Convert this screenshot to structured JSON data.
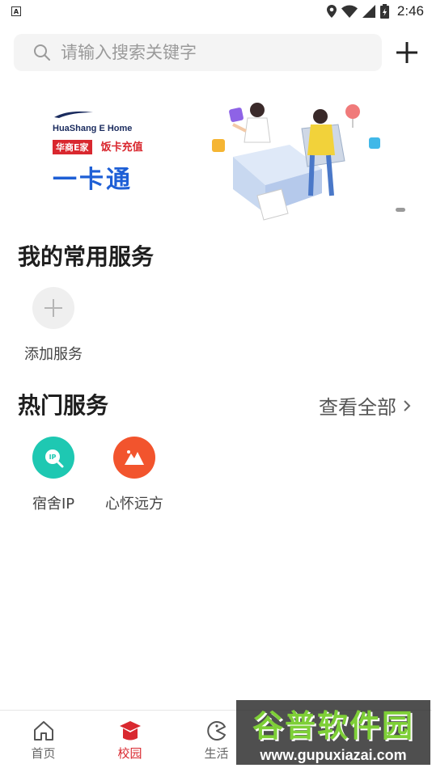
{
  "status_bar": {
    "sim_label": "A",
    "time": "2:46"
  },
  "search": {
    "placeholder": "请输入搜索关键字"
  },
  "banner": {
    "brand": "HuaShang E Home",
    "tag_left": "华商E家",
    "tag_right": "饭卡充值",
    "title": "一卡通"
  },
  "my_services": {
    "title": "我的常用服务",
    "items": [
      {
        "label": "添加服务",
        "icon": "plus-icon"
      }
    ]
  },
  "hot_services": {
    "title": "热门服务",
    "view_all": "查看全部",
    "items": [
      {
        "label": "宿舍IP",
        "icon": "ip-icon",
        "color": "#1ec8b2"
      },
      {
        "label": "心怀远方",
        "icon": "mountain-icon",
        "color": "#f2542d"
      }
    ]
  },
  "tabs": [
    {
      "label": "首页",
      "icon": "home-icon",
      "active": false
    },
    {
      "label": "校园",
      "icon": "campus-icon",
      "active": true
    },
    {
      "label": "生活",
      "icon": "life-icon",
      "active": false
    }
  ],
  "watermark": {
    "title": "谷普软件园",
    "url": "www.gupuxiazai.com"
  },
  "colors": {
    "accent": "#d9282f",
    "teal": "#1ec8b2",
    "orange": "#f2542d"
  }
}
